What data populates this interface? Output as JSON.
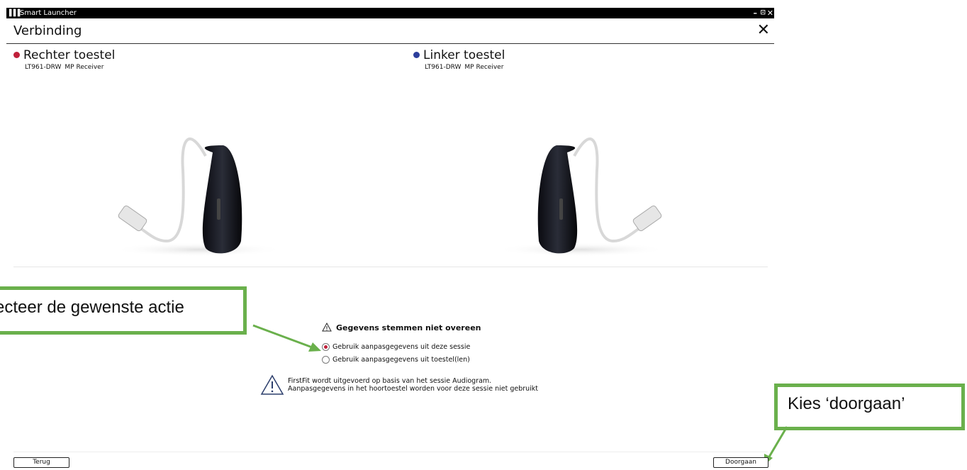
{
  "window": {
    "app_title": "Smart Launcher",
    "logo_glyph": "▌▌▌",
    "minimize": "–",
    "restore": "⊡",
    "close": "✕"
  },
  "header": {
    "title": "Verbinding",
    "close_glyph": "✕"
  },
  "devices": [
    {
      "name": "Rechter toestel",
      "model": "LT961-DRW",
      "receiver": "MP Receiver",
      "color": "#c0203a"
    },
    {
      "name": "Linker toestel",
      "model": "LT961-DRW",
      "receiver": "MP Receiver",
      "color": "#2c3e9c"
    }
  ],
  "callouts": {
    "select_action": "ecteer de gewenste actie",
    "continue": "Kies ‘doorgaan’"
  },
  "warning": {
    "heading": "Gegevens stemmen niet overeen",
    "options": [
      {
        "label": "Gebruik aanpasgegevens uit deze sessie",
        "selected": true
      },
      {
        "label": "Gebruik aanpasgegevens uit toestel(len)",
        "selected": false
      }
    ],
    "info_line1": "FirstFit wordt uitgevoerd op basis van het sessie Audiogram.",
    "info_line2": "Aanpasgegevens in het hoortoestel worden voor deze sessie niet gebruikt"
  },
  "footer": {
    "back_label": "Terug",
    "continue_label": "Doorgaan"
  },
  "colors": {
    "accent_green": "#6ab04c",
    "selected_red": "#c0203a"
  }
}
